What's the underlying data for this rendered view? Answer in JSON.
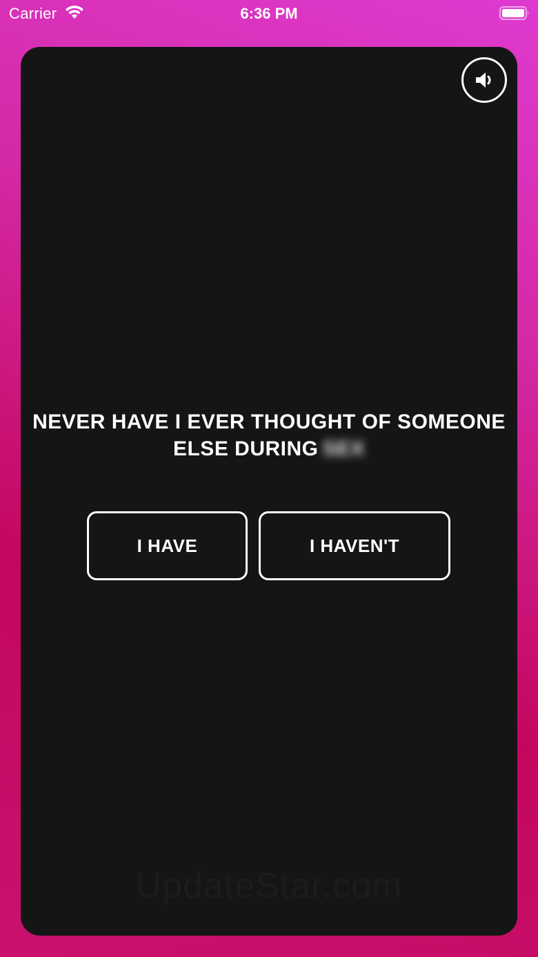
{
  "status_bar": {
    "carrier": "Carrier",
    "time": "6:36 PM"
  },
  "card": {
    "question_text": "NEVER HAVE I EVER THOUGHT OF SOMEONE ELSE DURING",
    "blurred_word": "SEX",
    "buttons": {
      "have_label": "I HAVE",
      "havent_label": "I HAVEN'T"
    },
    "sound_icon": "speaker-volume-icon"
  },
  "watermark": "UpdateStar.com",
  "colors": {
    "background_top": "#df3ad0",
    "background_bottom": "#c4075e",
    "card": "#151515",
    "text": "#ffffff"
  }
}
